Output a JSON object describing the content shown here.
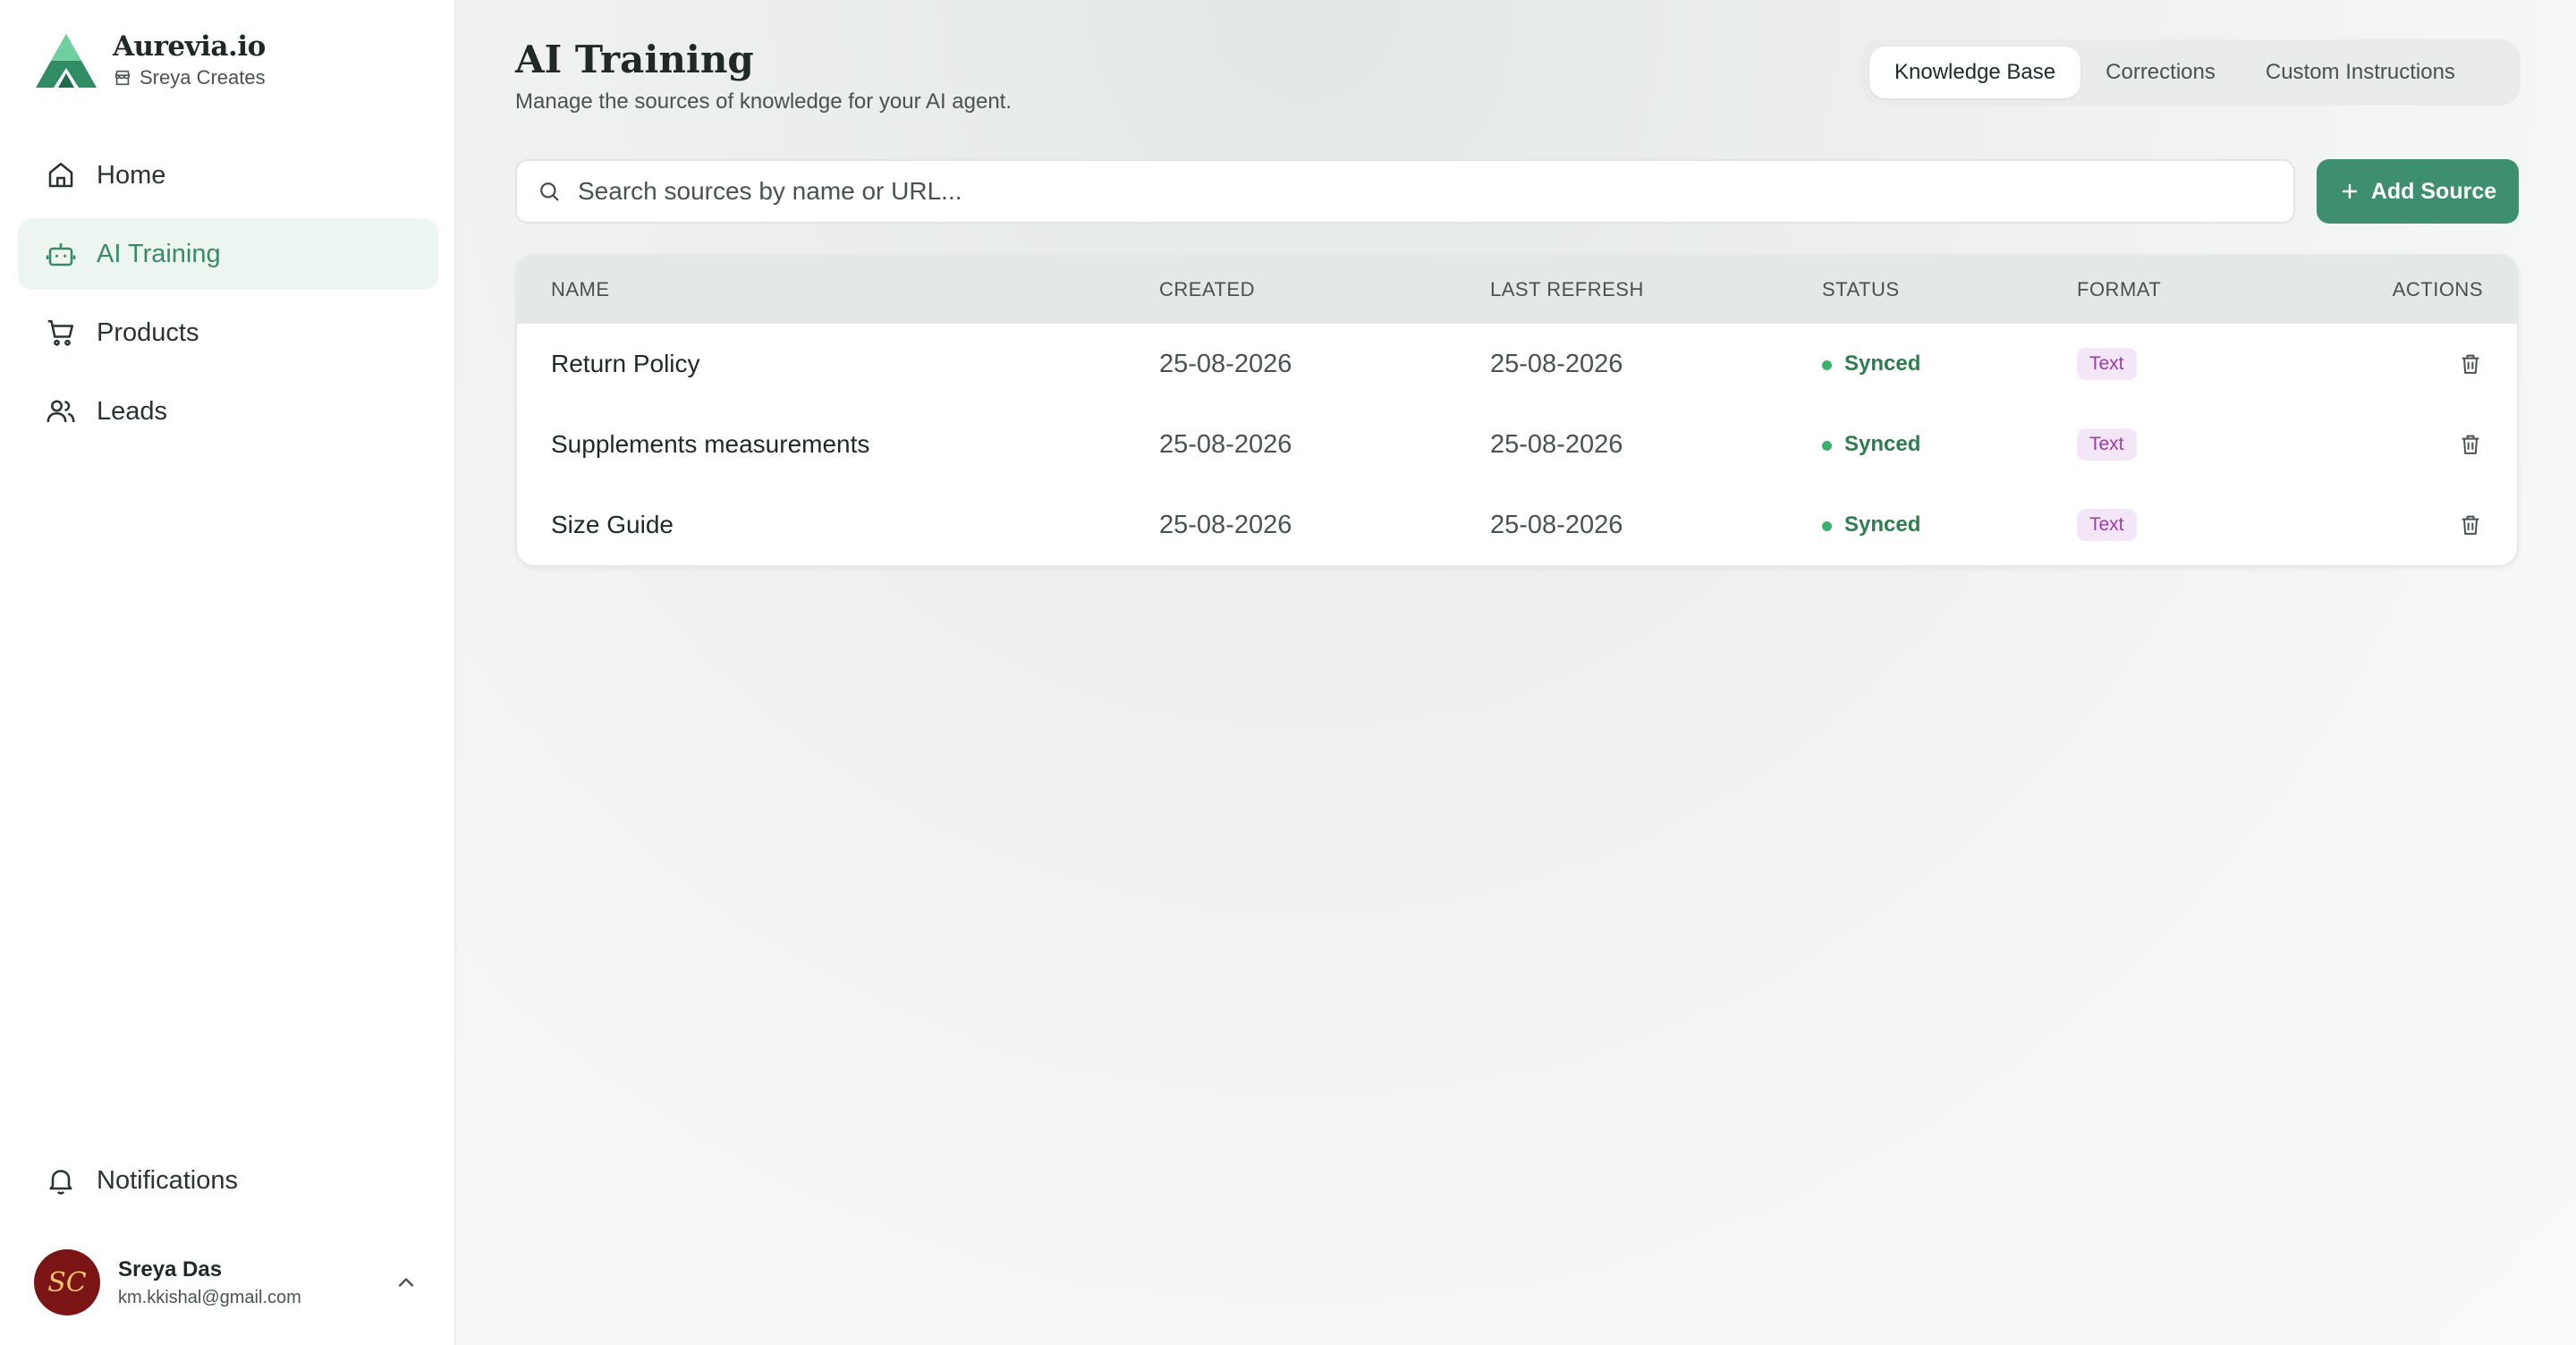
{
  "brand": {
    "name": "Aurevia.io",
    "workspace": "Sreya Creates"
  },
  "nav": {
    "items": [
      {
        "label": "Home",
        "icon": "home-icon"
      },
      {
        "label": "AI Training",
        "icon": "robot-icon",
        "active": true
      },
      {
        "label": "Products",
        "icon": "cart-icon"
      },
      {
        "label": "Leads",
        "icon": "users-icon"
      }
    ],
    "notifications": "Notifications"
  },
  "user": {
    "name": "Sreya Das",
    "email": "km.kkishal@gmail.com",
    "initials": "SC"
  },
  "page": {
    "title": "AI Training",
    "subtitle": "Manage the sources of knowledge for your AI agent."
  },
  "tabs": [
    {
      "label": "Knowledge Base",
      "active": true
    },
    {
      "label": "Corrections"
    },
    {
      "label": "Custom Instructions"
    }
  ],
  "search": {
    "placeholder": "Search sources by name or URL..."
  },
  "add_button": {
    "label": "Add Source"
  },
  "table": {
    "headers": {
      "name": "NAME",
      "created": "CREATED",
      "last_refresh": "LAST REFRESH",
      "status": "STATUS",
      "format": "FORMAT",
      "actions": "ACTIONS"
    },
    "rows": [
      {
        "name": "Return Policy",
        "created": "25-08-2026",
        "last_refresh": "25-08-2026",
        "status": "Synced",
        "format": "Text"
      },
      {
        "name": "Supplements measurements",
        "created": "25-08-2026",
        "last_refresh": "25-08-2026",
        "status": "Synced",
        "format": "Text"
      },
      {
        "name": "Size Guide",
        "created": "25-08-2026",
        "last_refresh": "25-08-2026",
        "status": "Synced",
        "format": "Text"
      }
    ]
  },
  "colors": {
    "accent": "#3e8f6f",
    "active_nav_bg": "#eef6f2",
    "status_green": "#2e7d4f",
    "badge_purple": "#9b3aa8",
    "avatar_bg": "#7b1414"
  }
}
